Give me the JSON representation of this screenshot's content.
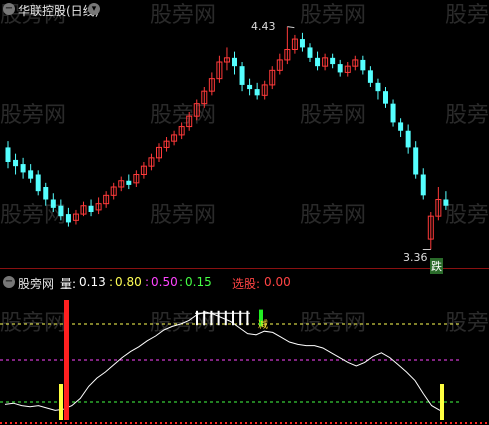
{
  "top_panel": {
    "title": "华联控股(日线)",
    "high_label": "4.43",
    "low_label": "3.36",
    "tag_label": "跌"
  },
  "bottom_panel": {
    "indicator_name": "股旁网",
    "legend": [
      {
        "key": "量:",
        "value": "0.13",
        "color": "#ffffff"
      },
      {
        "key": ":",
        "value": "0.80",
        "color": "#ffff55"
      },
      {
        "key": ":",
        "value": "0.50",
        "color": "#ff44ff"
      },
      {
        "key": ":",
        "value": "0.15",
        "color": "#44ff44"
      }
    ],
    "signal_label": "选股:",
    "signal_value": "0.00",
    "tag_label": "减"
  },
  "watermark": "股旁网",
  "colors": {
    "up": "#ff3a3a",
    "down": "#55ffff",
    "background": "#000000"
  },
  "chart_data": {
    "type": "candlestick",
    "series": [
      {
        "name": "华联控股(日线)",
        "high": 4.43,
        "low": 3.36
      },
      {
        "name": "量",
        "levels": [
          0.13,
          0.8,
          0.5,
          0.15
        ]
      }
    ],
    "candles": [
      [
        3.85,
        3.78,
        3.88,
        3.75
      ],
      [
        3.79,
        3.76,
        3.82,
        3.72
      ],
      [
        3.77,
        3.73,
        3.8,
        3.7
      ],
      [
        3.74,
        3.7,
        3.77,
        3.68
      ],
      [
        3.72,
        3.64,
        3.74,
        3.62
      ],
      [
        3.66,
        3.6,
        3.68,
        3.57
      ],
      [
        3.6,
        3.56,
        3.63,
        3.54
      ],
      [
        3.57,
        3.52,
        3.6,
        3.5
      ],
      [
        3.53,
        3.49,
        3.56,
        3.47
      ],
      [
        3.5,
        3.53,
        3.55,
        3.48
      ],
      [
        3.53,
        3.57,
        3.59,
        3.52
      ],
      [
        3.57,
        3.54,
        3.6,
        3.52
      ],
      [
        3.55,
        3.58,
        3.61,
        3.53
      ],
      [
        3.58,
        3.62,
        3.64,
        3.56
      ],
      [
        3.62,
        3.66,
        3.68,
        3.6
      ],
      [
        3.66,
        3.69,
        3.71,
        3.64
      ],
      [
        3.69,
        3.67,
        3.72,
        3.65
      ],
      [
        3.68,
        3.72,
        3.74,
        3.66
      ],
      [
        3.72,
        3.76,
        3.78,
        3.7
      ],
      [
        3.76,
        3.8,
        3.82,
        3.74
      ],
      [
        3.8,
        3.85,
        3.87,
        3.78
      ],
      [
        3.85,
        3.88,
        3.9,
        3.83
      ],
      [
        3.88,
        3.91,
        3.93,
        3.86
      ],
      [
        3.91,
        3.95,
        3.97,
        3.89
      ],
      [
        3.95,
        4.0,
        4.02,
        3.93
      ],
      [
        4.0,
        4.06,
        4.08,
        3.98
      ],
      [
        4.06,
        4.12,
        4.14,
        4.04
      ],
      [
        4.12,
        4.18,
        4.21,
        4.1
      ],
      [
        4.18,
        4.26,
        4.29,
        4.16
      ],
      [
        4.26,
        4.28,
        4.33,
        4.22
      ],
      [
        4.28,
        4.24,
        4.31,
        4.2
      ],
      [
        4.24,
        4.15,
        4.26,
        4.12
      ],
      [
        4.15,
        4.13,
        4.18,
        4.1
      ],
      [
        4.13,
        4.1,
        4.16,
        4.08
      ],
      [
        4.1,
        4.15,
        4.17,
        4.08
      ],
      [
        4.15,
        4.22,
        4.24,
        4.13
      ],
      [
        4.22,
        4.27,
        4.3,
        4.2
      ],
      [
        4.27,
        4.32,
        4.43,
        4.25
      ],
      [
        4.32,
        4.37,
        4.39,
        4.3
      ],
      [
        4.37,
        4.33,
        4.4,
        4.31
      ],
      [
        4.33,
        4.28,
        4.35,
        4.26
      ],
      [
        4.28,
        4.24,
        4.31,
        4.22
      ],
      [
        4.24,
        4.28,
        4.3,
        4.22
      ],
      [
        4.28,
        4.25,
        4.3,
        4.23
      ],
      [
        4.25,
        4.21,
        4.27,
        4.19
      ],
      [
        4.21,
        4.24,
        4.26,
        4.19
      ],
      [
        4.24,
        4.27,
        4.29,
        4.22
      ],
      [
        4.27,
        4.22,
        4.29,
        4.2
      ],
      [
        4.22,
        4.16,
        4.24,
        4.14
      ],
      [
        4.16,
        4.12,
        4.18,
        4.08
      ],
      [
        4.12,
        4.06,
        4.14,
        4.04
      ],
      [
        4.06,
        3.97,
        4.08,
        3.95
      ],
      [
        3.97,
        3.93,
        3.99,
        3.9
      ],
      [
        3.93,
        3.85,
        3.96,
        3.82
      ],
      [
        3.85,
        3.72,
        3.88,
        3.7
      ],
      [
        3.72,
        3.62,
        3.75,
        3.6
      ],
      [
        3.41,
        3.52,
        3.54,
        3.36
      ],
      [
        3.52,
        3.6,
        3.66,
        3.5
      ],
      [
        3.6,
        3.57,
        3.64,
        3.55
      ]
    ],
    "indicator_line": [
      0.13,
      0.14,
      0.12,
      0.11,
      0.12,
      0.1,
      0.08,
      0.09,
      0.12,
      0.18,
      0.28,
      0.35,
      0.4,
      0.46,
      0.52,
      0.57,
      0.61,
      0.66,
      0.7,
      0.75,
      0.78,
      0.8,
      0.83,
      0.88,
      0.9,
      0.88,
      0.85,
      0.82,
      0.77,
      0.72,
      0.71,
      0.74,
      0.73,
      0.69,
      0.65,
      0.63,
      0.62,
      0.62,
      0.6,
      0.56,
      0.52,
      0.48,
      0.45,
      0.48,
      0.53,
      0.56,
      0.52,
      0.46,
      0.4,
      0.33,
      0.22,
      0.12,
      0.08
    ],
    "indicator_levels": [
      {
        "value": 0.8,
        "color": "#ffff55",
        "style": "dashed"
      },
      {
        "value": 0.5,
        "color": "#ff44ff",
        "style": "dashed"
      },
      {
        "value": 0.15,
        "color": "#44ff44",
        "style": "dashed"
      }
    ],
    "indicator_bars": [
      {
        "index": 10,
        "color": "#ff2020",
        "from": 0.0,
        "to": 1.0
      },
      {
        "index": 9,
        "color": "#ffff40",
        "from": 0.0,
        "to": 0.3
      },
      {
        "index": 49,
        "color": "#ffff40",
        "from": 0.0,
        "to": 0.3
      },
      {
        "index": 29,
        "color": "#22ee22",
        "from": 0.78,
        "to": 0.92
      }
    ],
    "indicator_ticks": [
      21,
      22,
      23,
      24,
      25,
      26,
      27,
      28
    ]
  }
}
